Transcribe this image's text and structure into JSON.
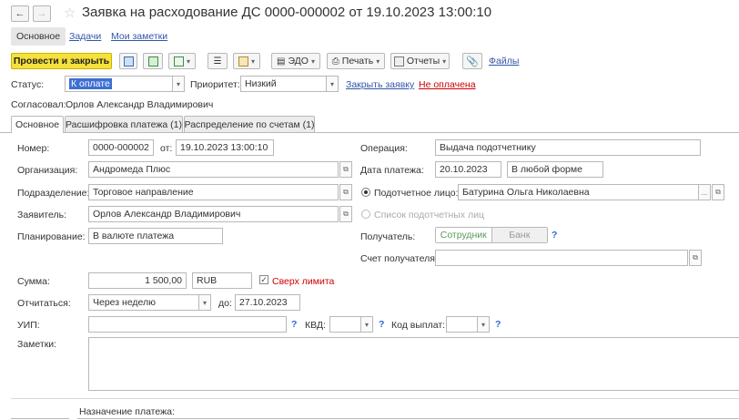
{
  "window": {
    "title": "Заявка на расходование ДС 0000-000002 от 19.10.2023 13:00:10"
  },
  "nav_tabs": [
    {
      "label": "Основное"
    },
    {
      "label": "Задачи"
    },
    {
      "label": "Мои заметки"
    }
  ],
  "toolbar": {
    "post_close_label": "Провести и закрыть",
    "edo_label": "ЭДО",
    "print_label": "Печать",
    "reports_label": "Отчеты",
    "files_label": "Файлы"
  },
  "status_row": {
    "status_label": "Статус:",
    "status_value": "К оплате",
    "priority_label": "Приоритет:",
    "priority_value": "Низкий",
    "close_link": "Закрыть заявку",
    "unpaid_link": "Не оплачена"
  },
  "approved": {
    "label": "Согласовал:",
    "value": "Орлов Александр Владимирович"
  },
  "form_tabs": [
    {
      "label": "Основное"
    },
    {
      "label": "Расшифровка платежа (1)"
    },
    {
      "label": "Распределение по счетам (1)"
    }
  ],
  "form": {
    "number_label": "Номер:",
    "number_value": "0000-000002",
    "from_label": "от:",
    "date_value": "19.10.2023 13:00:10",
    "operation_label": "Операция:",
    "operation_value": "Выдача подотчетнику",
    "org_label": "Организация:",
    "org_value": "Андромеда Плюс",
    "pay_date_label": "Дата платежа:",
    "pay_date_value": "20.10.2023",
    "pay_form_value": "В любой форме",
    "dept_label": "Подразделение:",
    "dept_value": "Торговое направление",
    "accountable_label": "Подотчетное лицо:",
    "accountable_value": "Батурина Ольга Николаевна",
    "applicant_label": "Заявитель:",
    "applicant_value": "Орлов Александр Владимирович",
    "accountable_list_label": "Список подотчетных лиц",
    "planning_label": "Планирование:",
    "planning_value": "В валюте платежа",
    "recipient_label": "Получатель:",
    "recipient_opt1": "Сотрудник",
    "recipient_opt2": "Банк",
    "recipient_account_label": "Счет получателя:",
    "sum_label": "Сумма:",
    "sum_value": "1 500,00",
    "currency_value": "RUB",
    "over_limit_label": "Сверх лимита",
    "report_label": "Отчитаться:",
    "report_value": "Через неделю",
    "until_label": "до:",
    "until_value": "27.10.2023",
    "uip_label": "УИП:",
    "kvd_label": "КВД:",
    "pay_code_label": "Код выплат:",
    "notes_label": "Заметки:",
    "purpose_label": "Назначение платежа:"
  },
  "colors": {
    "primary_button": "#f5e139",
    "link": "#3355aa",
    "alert_red": "#cc0000",
    "selected_field": "#3d6fd4"
  }
}
